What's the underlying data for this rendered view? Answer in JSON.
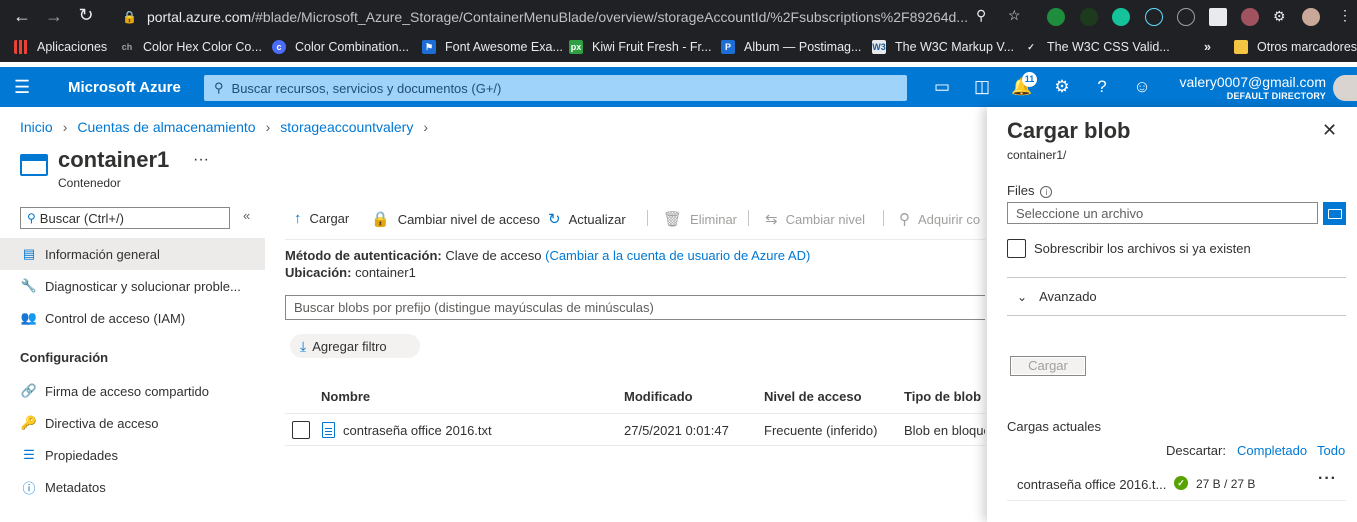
{
  "browser": {
    "url_host": "portal.azure.com",
    "url_path": "/#blade/Microsoft_Azure_Storage/ContainerMenuBlade/overview/storageAccountId/%2Fsubscriptions%2F89264d...",
    "bookmarks": [
      {
        "label": "Aplicaciones",
        "color": "#e8eaed"
      },
      {
        "label": "Color Hex Color Co...",
        "color": "#5f6368"
      },
      {
        "label": "Color Combination...",
        "color": "#4a6cf7"
      },
      {
        "label": "Font Awesome Exa...",
        "color": "#1c6ed6"
      },
      {
        "label": "Kiwi Fruit Fresh - Fr...",
        "color": "#2ea043"
      },
      {
        "label": "Album — Postimag...",
        "color": "#1c6ed6"
      },
      {
        "label": "The W3C Markup V...",
        "color": "#e8eaed"
      },
      {
        "label": "The W3C CSS Valid...",
        "color": "#e8eaed"
      }
    ],
    "other_bookmarks": "Otros marcadores"
  },
  "header": {
    "brand": "Microsoft Azure",
    "search_placeholder": "Buscar recursos, servicios y documentos (G+/)",
    "notifications_count": "11",
    "user_email": "valery0007@gmail.com",
    "user_directory": "DEFAULT DIRECTORY",
    "accent": "#0078d4"
  },
  "breadcrumb": [
    "Inicio",
    "Cuentas de almacenamiento",
    "storageaccountvalery"
  ],
  "page": {
    "title": "container1",
    "subtitle": "Contenedor"
  },
  "menu": {
    "search_placeholder": "Buscar (Ctrl+/)",
    "items": [
      {
        "label": "Información general",
        "icon": "overview-icon"
      },
      {
        "label": "Diagnosticar y solucionar proble...",
        "icon": "wrench-icon"
      },
      {
        "label": "Control de acceso (IAM)",
        "icon": "people-icon"
      }
    ],
    "group_title": "Configuración",
    "config_items": [
      {
        "label": "Firma de acceso compartido",
        "icon": "link-icon"
      },
      {
        "label": "Directiva de acceso",
        "icon": "key-icon"
      },
      {
        "label": "Propiedades",
        "icon": "properties-icon"
      },
      {
        "label": "Metadatos",
        "icon": "info-icon"
      }
    ]
  },
  "toolbar": {
    "upload": "Cargar",
    "change_access": "Cambiar nivel de acceso",
    "refresh": "Actualizar",
    "delete": "Eliminar",
    "change_tier": "Cambiar nivel",
    "acquire": "Adquirir co"
  },
  "overview": {
    "auth_label": "Método de autenticación:",
    "auth_value": "Clave de acceso",
    "auth_link": "(Cambiar a la cuenta de usuario de Azure AD)",
    "location_label": "Ubicación:",
    "location_value": "container1",
    "blob_search_placeholder": "Buscar blobs por prefijo (distingue mayúsculas de minúsculas)",
    "add_filter": "Agregar filtro"
  },
  "table": {
    "columns": [
      "Nombre",
      "Modificado",
      "Nivel de acceso",
      "Tipo de blob"
    ],
    "rows": [
      {
        "name": "contraseña office 2016.txt",
        "modified": "27/5/2021 0:01:47",
        "tier": "Frecuente (inferido)",
        "type": "Blob en bloque"
      }
    ]
  },
  "panel": {
    "title": "Cargar blob",
    "subtitle": "container1/",
    "files_label": "Files",
    "file_placeholder": "Seleccione un archivo",
    "overwrite_label": "Sobrescribir los archivos si ya existen",
    "advanced": "Avanzado",
    "upload_button": "Cargar",
    "current_uploads": "Cargas actuales",
    "discard_label": "Descartar:",
    "discard_completed": "Completado",
    "discard_all": "Todo",
    "upload_item": {
      "name": "contraseña office 2016.t...",
      "size": "27 B / 27 B"
    }
  }
}
